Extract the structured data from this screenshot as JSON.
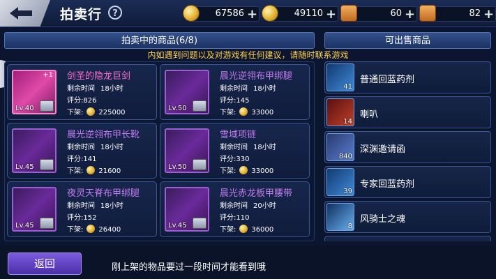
{
  "header": {
    "title": "拍卖行",
    "help_label": "?",
    "currencies": [
      {
        "icon": "gold-coin-icon",
        "value": "67586"
      },
      {
        "icon": "gold-coin-stack-icon",
        "value": "49110"
      },
      {
        "icon": "scroll-ticket-icon",
        "value": "60"
      },
      {
        "icon": "locked-scroll-icon",
        "value": "82"
      }
    ],
    "plus_label": "+"
  },
  "left_panel": {
    "title": "拍卖中的商品(6/8)"
  },
  "right_panel": {
    "title": "可出售商品"
  },
  "notice": "内如遇到问题以及对游戏有任何建议，请随时联系游戏",
  "auction_items": [
    {
      "name": "剑圣的隐龙巨剑",
      "level": "Lv.40",
      "corner": "+1",
      "time_label": "剩余时间",
      "time": "18小时",
      "score_label": "评分:",
      "score": "826",
      "price_label": "下架:",
      "price": "225000",
      "rarity": "pink"
    },
    {
      "name": "晨光逆翎布甲绑腿",
      "level": "Lv.50",
      "corner": "",
      "time_label": "剩余时间",
      "time": "18小时",
      "score_label": "评分:",
      "score": "145",
      "price_label": "下架:",
      "price": "33000",
      "rarity": "purple"
    },
    {
      "name": "晨光逆翎布甲长靴",
      "level": "Lv.45",
      "corner": "",
      "time_label": "剩余时间",
      "time": "18小时",
      "score_label": "评分:",
      "score": "141",
      "price_label": "下架:",
      "price": "21600",
      "rarity": "purple"
    },
    {
      "name": "雪域项链",
      "level": "Lv.50",
      "corner": "",
      "time_label": "剩余时间",
      "time": "18小时",
      "score_label": "评分:",
      "score": "330",
      "price_label": "下架:",
      "price": "33000",
      "rarity": "purple"
    },
    {
      "name": "夜灵天脊布甲绑腿",
      "level": "Lv.45",
      "corner": "",
      "time_label": "剩余时间",
      "time": "18小时",
      "score_label": "评分:",
      "score": "152",
      "price_label": "下架:",
      "price": "26400",
      "rarity": "purple"
    },
    {
      "name": "晨光赤龙板甲腰带",
      "level": "Lv.45",
      "corner": "",
      "time_label": "剩余时间",
      "time": "20小时",
      "score_label": "评分:",
      "score": "110",
      "price_label": "下架:",
      "price": "36000",
      "rarity": "purple"
    }
  ],
  "sellable_items": [
    {
      "name": "普通回蓝药剂",
      "count": "41"
    },
    {
      "name": "喇叭",
      "count": "14"
    },
    {
      "name": "深渊邀请函",
      "count": "840"
    },
    {
      "name": "专家回蓝药剂",
      "count": "39"
    },
    {
      "name": "风骑士之魂",
      "count": "8"
    }
  ],
  "footer": {
    "back_label": "返回",
    "message": "刚上架的物品要过一段时间才能看到哦"
  }
}
